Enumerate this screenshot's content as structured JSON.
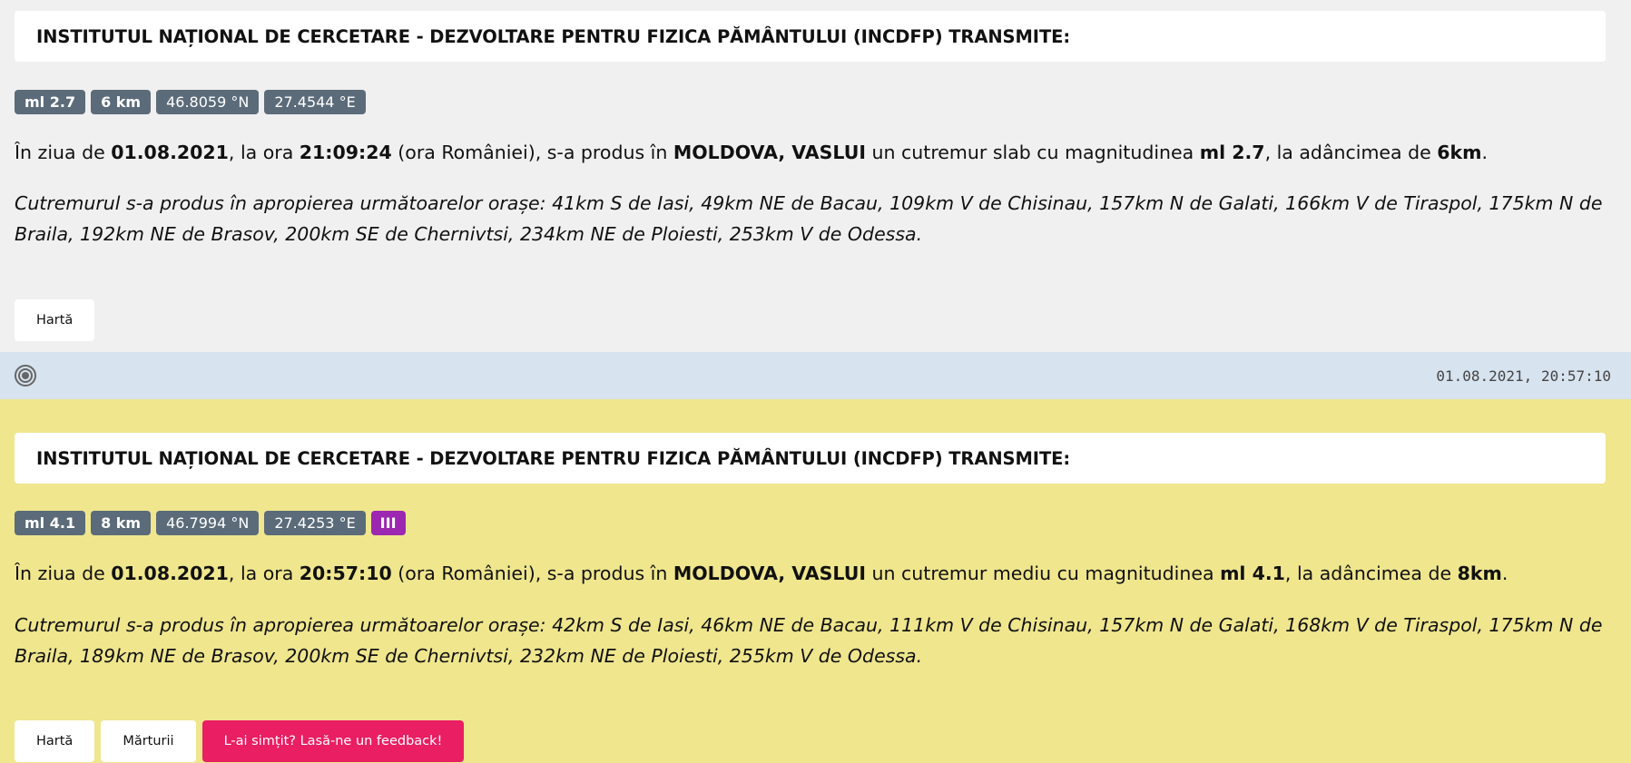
{
  "quakes": [
    {
      "title": "INSTITUTUL NAȚIONAL DE CERCETARE - DEZVOLTARE PENTRU FIZICA PĂMÂNTULUI (INCDFP) TRANSMITE:",
      "tags": {
        "magnitude": "ml 2.7",
        "depth": "6 km",
        "lat": "46.8059 °N",
        "lon": "27.4544 °E"
      },
      "summary": {
        "p1": "În ziua de ",
        "date": "01.08.2021",
        "p2": ", la ora ",
        "time": "21:09:24",
        "p3": " (ora României), s-a produs în ",
        "region": "MOLDOVA, VASLUI",
        "p4": " un cutremur slab cu magnitudinea ",
        "magnitude": "ml 2.7",
        "p5": ", la adâncimea de ",
        "depth": "6km",
        "p6": "."
      },
      "nearby": "Cutremurul s-a produs în apropierea următoarelor orașe: 41km S de Iasi, 49km NE de Bacau, 109km V de Chisinau, 157km N de Galati, 166km V de Tiraspol, 175km N de Braila, 192km NE de Brasov, 200km SE de Chernivtsi, 234km NE de Ploiesti, 253km V de Odessa.",
      "buttons": {
        "map": "Hartă"
      }
    },
    {
      "title": "INSTITUTUL NAȚIONAL DE CERCETARE - DEZVOLTARE PENTRU FIZICA PĂMÂNTULUI (INCDFP) TRANSMITE:",
      "tags": {
        "magnitude": "ml 4.1",
        "depth": "8 km",
        "lat": "46.7994 °N",
        "lon": "27.4253 °E",
        "intensity": "III"
      },
      "summary": {
        "p1": "În ziua de ",
        "date": "01.08.2021",
        "p2": ", la ora ",
        "time": "20:57:10",
        "p3": " (ora României), s-a produs în ",
        "region": "MOLDOVA, VASLUI",
        "p4": " un cutremur mediu cu magnitudinea ",
        "magnitude": "ml 4.1",
        "p5": ", la adâncimea de ",
        "depth": "8km",
        "p6": "."
      },
      "nearby": "Cutremurul s-a produs în apropierea următoarelor orașe: 42km S de Iasi, 46km NE de Bacau, 111km V de Chisinau, 157km N de Galati, 168km V de Tiraspol, 175km N de Braila, 189km NE de Brasov, 200km SE de Chernivtsi, 232km NE de Ploiesti, 255km V de Odessa.",
      "buttons": {
        "map": "Hartă",
        "testimonials": "Mărturii",
        "feedback": "L-ai simțit? Lasă-ne un feedback!"
      }
    }
  ],
  "meta_bar": {
    "icon": "seismic-target-icon",
    "timestamp": "01.08.2021, 20:57:10"
  },
  "colors": {
    "card_gray": "#f0f0f0",
    "card_yellow": "#efe68e",
    "meta_blue": "#d7e3ef",
    "tag_slate": "#5b6b79",
    "intensity_purple": "#9c27b0",
    "feedback_pink": "#e91e63"
  }
}
